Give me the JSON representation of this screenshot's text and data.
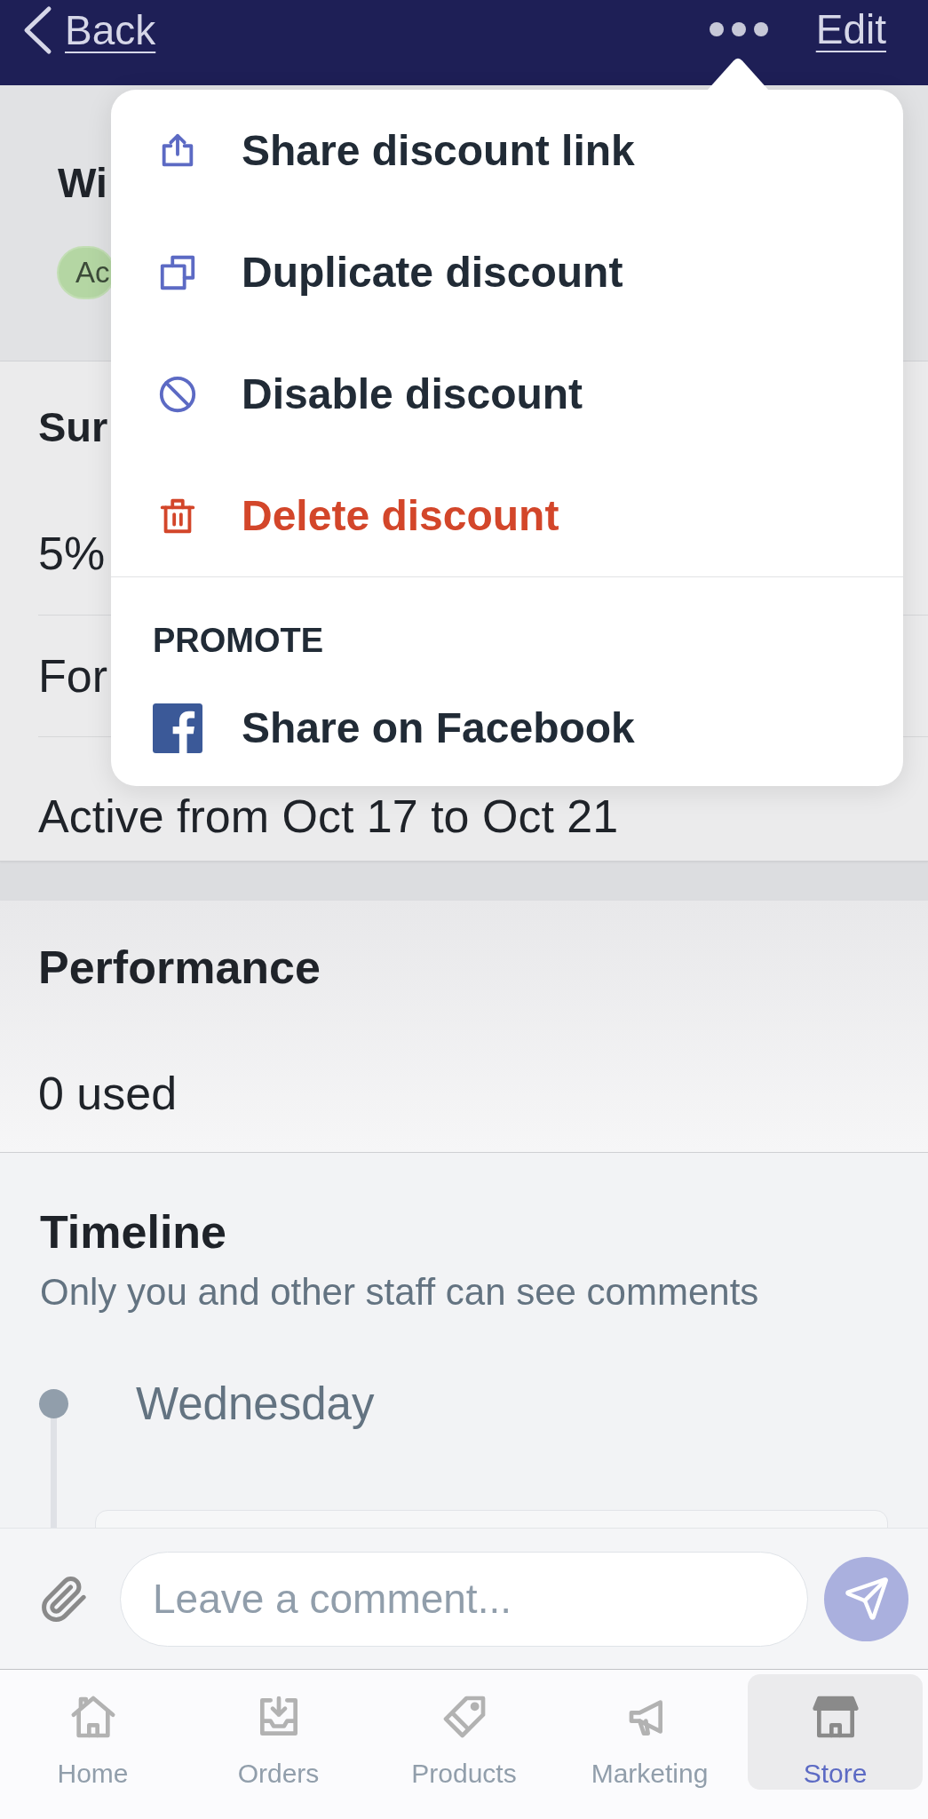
{
  "nav_bar": {
    "back_label": "Back",
    "edit_label": "Edit"
  },
  "actions_menu": {
    "items": [
      {
        "kind": "share",
        "label": "Share discount link",
        "destructive": false
      },
      {
        "kind": "duplicate",
        "label": "Duplicate discount",
        "destructive": false
      },
      {
        "kind": "disable",
        "label": "Disable discount",
        "destructive": false
      },
      {
        "kind": "delete",
        "label": "Delete discount",
        "destructive": true
      }
    ],
    "sections": [
      {
        "heading": "PROMOTE",
        "items": [
          {
            "kind": "facebook",
            "label": "Share on Facebook",
            "destructive": false
          }
        ]
      }
    ]
  },
  "discount": {
    "title": "Wi",
    "status_badge": "Ac"
  },
  "summary_card": {
    "heading": "Sur",
    "lines": [
      "5%",
      "For",
      "Active from Oct 17 to Oct 21"
    ]
  },
  "performance_card": {
    "heading": "Performance",
    "lines": [
      "0 used"
    ]
  },
  "timeline": {
    "heading": "Timeline",
    "subtitle": "Only you and other staff can see comments",
    "entries": [
      {
        "date": "Wednesday"
      }
    ]
  },
  "comment_bar": {
    "placeholder": "Leave a comment..."
  },
  "tab_bar": {
    "tabs": [
      {
        "kind": "home",
        "label": "Home",
        "selected": false
      },
      {
        "kind": "orders",
        "label": "Orders",
        "selected": false
      },
      {
        "kind": "products",
        "label": "Products",
        "selected": false
      },
      {
        "kind": "marketing",
        "label": "Marketing",
        "selected": false
      },
      {
        "kind": "store",
        "label": "Store",
        "selected": true
      }
    ]
  }
}
